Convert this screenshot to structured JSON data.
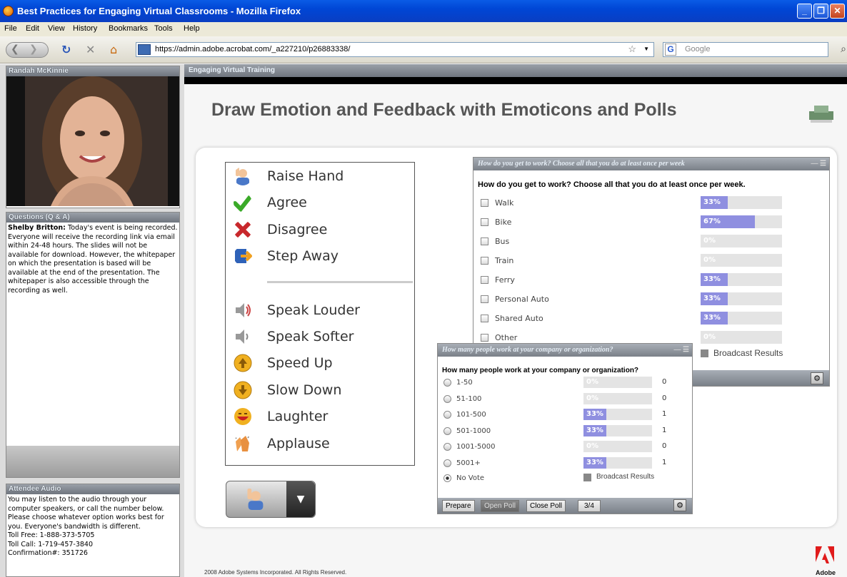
{
  "window": {
    "title": "Best Practices for Engaging Virtual Classrooms - Mozilla Firefox"
  },
  "menu": [
    "File",
    "Edit",
    "View",
    "History",
    "Bookmarks",
    "Tools",
    "Help"
  ],
  "nav": {
    "url": "https://admin.adobe.acrobat.com/_a227210/p26883338/",
    "search_placeholder": "Google"
  },
  "video_pod": {
    "title": "Randah McKinnie"
  },
  "qa_pod": {
    "title": "Questions (Q & A)",
    "author": "Shelby Britton:",
    "message": "Today's event is being recorded. Everyone will receive the recording link via email within 24-48 hours. The slides will not be available for download. However, the whitepaper on which the presentation is based will be available at the end of the presentation.  The whitepaper is also accessible through the recording as well."
  },
  "audio_pod": {
    "title": "Attendee Audio",
    "message": "You may listen to the audio through your computer speakers, or call the number below. Please choose whatever option works best for you. Everyone's bandwidth is different.",
    "toll_free": "Toll Free: 1-888-373-5705",
    "toll_call": "Toll Call: 1-719-457-3840",
    "confirmation": "Confirmation#: 351726"
  },
  "stage": {
    "title": "Engaging Virtual Training",
    "slide_title": "Draw Emotion and Feedback with Emoticons and Polls",
    "footer": "2008 Adobe Systems Incorporated. All Rights Reserved.",
    "brand": "Adobe"
  },
  "emoticons": [
    {
      "label": "Raise Hand",
      "icon": "raise-hand-icon",
      "color": "#4a78c8"
    },
    {
      "label": "Agree",
      "icon": "checkmark-icon",
      "color": "#3aaa28"
    },
    {
      "label": "Disagree",
      "icon": "x-mark-icon",
      "color": "#c8282c"
    },
    {
      "label": "Step Away",
      "icon": "step-away-icon",
      "color": "#2f62b8"
    },
    {
      "label": "Speak Louder",
      "icon": "speaker-loud-icon",
      "color": "#999999"
    },
    {
      "label": "Speak Softer",
      "icon": "speaker-soft-icon",
      "color": "#999999"
    },
    {
      "label": "Speed Up",
      "icon": "arrow-up-icon",
      "color": "#f0b020"
    },
    {
      "label": "Slow Down",
      "icon": "arrow-down-icon",
      "color": "#f0b020"
    },
    {
      "label": "Laughter",
      "icon": "laughing-face-icon",
      "color": "#f0b020"
    },
    {
      "label": "Applause",
      "icon": "clapping-hands-icon",
      "color": "#f0a050"
    }
  ],
  "poll1": {
    "header": "How do you get to work? Choose all that you do at least once per week",
    "question": "How do you get to work? Choose all that you do at least once per week.",
    "options": [
      {
        "label": "Walk",
        "pct": 33,
        "text": "33%"
      },
      {
        "label": "Bike",
        "pct": 67,
        "text": "67%"
      },
      {
        "label": "Bus",
        "pct": 0,
        "text": "0%"
      },
      {
        "label": "Train",
        "pct": 0,
        "text": "0%"
      },
      {
        "label": "Ferry",
        "pct": 33,
        "text": "33%"
      },
      {
        "label": "Personal Auto",
        "pct": 33,
        "text": "33%"
      },
      {
        "label": "Shared Auto",
        "pct": 33,
        "text": "33%"
      },
      {
        "label": "Other",
        "pct": 0,
        "text": "0%"
      }
    ],
    "broadcast": "Broadcast Results"
  },
  "poll2": {
    "header": "How many people work at your company or organization?",
    "question": "How many people work at your company or organization?",
    "options": [
      {
        "label": "1-50",
        "pct": 0,
        "text": "0%",
        "count": "0"
      },
      {
        "label": "51-100",
        "pct": 0,
        "text": "0%",
        "count": "0"
      },
      {
        "label": "101-500",
        "pct": 33,
        "text": "33%",
        "count": "1"
      },
      {
        "label": "501-1000",
        "pct": 33,
        "text": "33%",
        "count": "1"
      },
      {
        "label": "1001-5000",
        "pct": 0,
        "text": "0%",
        "count": "0"
      },
      {
        "label": "5001+",
        "pct": 33,
        "text": "33%",
        "count": "1"
      }
    ],
    "no_vote": "No Vote",
    "broadcast": "Broadcast Results",
    "buttons": {
      "prepare": "Prepare",
      "open": "Open Poll",
      "close": "Close Poll",
      "page": "3/4"
    }
  }
}
